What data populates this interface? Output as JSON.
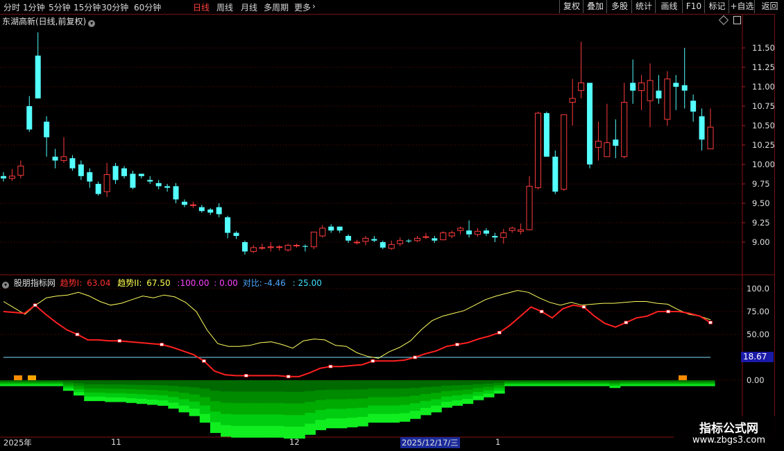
{
  "toolbar": {
    "periods": [
      {
        "label": "分时",
        "active": false
      },
      {
        "label": "1分钟",
        "active": false
      },
      {
        "label": "5分钟",
        "active": false
      },
      {
        "label": "15分钟",
        "active": false
      },
      {
        "label": "30分钟",
        "active": false
      },
      {
        "label": "60分钟",
        "active": false
      },
      {
        "label": "日线",
        "active": true
      },
      {
        "label": "周线",
        "active": false
      },
      {
        "label": "月线",
        "active": false
      },
      {
        "label": "多周期",
        "active": false
      },
      {
        "label": "更多",
        "active": false
      }
    ],
    "right_buttons": [
      "复权",
      "叠加",
      "多股",
      "统计",
      "画线",
      "F10",
      "标记",
      "+自选",
      "返回"
    ]
  },
  "symbol_title": "东湖高新(日线,前复权)",
  "indicator": {
    "name": "股朋指标网",
    "trend1_label": "趋势I:",
    "trend1_value": "63.04",
    "trend2_label": "趋势II:",
    "trend2_value": "67.50",
    "c100": ":100.00",
    "c0": ": 0.00",
    "contrast_label": "对比:",
    "contrast_value": "-4.46",
    "c25": ": 25.00"
  },
  "price_axis": [
    "11.50",
    "11.25",
    "11.00",
    "10.75",
    "10.50",
    "10.25",
    "10.00",
    "9.75",
    "9.50",
    "9.25",
    "9.00"
  ],
  "ind_axis": [
    "100.0",
    "75.00",
    "50.00",
    "0.00"
  ],
  "level_box": "18.67",
  "date_labels": [
    "2025年",
    "11",
    "12",
    "1"
  ],
  "cursor_date": "2025/12/17/三",
  "watermark": {
    "line1": "指标公式网",
    "line2": "www.zbgs3.com"
  },
  "colors": {
    "up": "#ff3c3c",
    "down": "#54ffff",
    "trend1": "#ff2020",
    "trend2": "#ffff60"
  },
  "chart_data": {
    "type": "candlestick",
    "candles": [
      [
        9.85,
        9.82,
        9.9,
        9.78
      ],
      [
        9.82,
        9.85,
        9.94,
        9.79
      ],
      [
        9.86,
        9.98,
        10.05,
        9.82
      ],
      [
        10.75,
        10.45,
        10.88,
        10.42
      ],
      [
        11.4,
        10.85,
        11.7,
        10.85
      ],
      [
        10.55,
        10.35,
        10.62,
        10.1
      ],
      [
        10.1,
        10.05,
        10.2,
        9.95
      ],
      [
        10.05,
        10.1,
        10.35,
        10.02
      ],
      [
        10.08,
        9.95,
        10.12,
        9.92
      ],
      [
        10.0,
        9.85,
        10.05,
        9.8
      ],
      [
        9.9,
        9.78,
        9.95,
        9.7
      ],
      [
        9.75,
        9.62,
        9.78,
        9.6
      ],
      [
        9.65,
        9.87,
        10.02,
        9.58
      ],
      [
        9.98,
        9.8,
        10.02,
        9.75
      ],
      [
        9.95,
        9.85,
        9.98,
        9.82
      ],
      [
        9.88,
        9.7,
        9.92,
        9.68
      ],
      [
        9.88,
        9.85,
        9.88,
        9.82
      ],
      [
        9.8,
        9.78,
        9.85,
        9.75
      ],
      [
        9.76,
        9.72,
        9.8,
        9.68
      ],
      [
        9.72,
        9.7,
        9.75,
        9.65
      ],
      [
        9.72,
        9.55,
        9.76,
        9.5
      ],
      [
        9.52,
        9.48,
        9.55,
        9.45
      ],
      [
        9.48,
        9.48,
        9.52,
        9.44
      ],
      [
        9.45,
        9.4,
        9.48,
        9.38
      ],
      [
        9.42,
        9.38,
        9.44,
        9.35
      ],
      [
        9.45,
        9.36,
        9.5,
        9.32
      ],
      [
        9.32,
        9.12,
        9.34,
        9.05
      ],
      [
        9.12,
        9.08,
        9.14,
        9.04
      ],
      [
        9.0,
        8.88,
        9.02,
        8.84
      ],
      [
        8.88,
        8.93,
        8.96,
        8.86
      ],
      [
        8.93,
        8.93,
        8.98,
        8.9
      ],
      [
        8.93,
        8.94,
        9.0,
        8.88
      ],
      [
        8.94,
        8.94,
        8.96,
        8.89
      ],
      [
        8.9,
        8.96,
        8.98,
        8.88
      ],
      [
        8.96,
        8.96,
        8.98,
        8.93
      ],
      [
        8.95,
        8.94,
        8.97,
        8.88
      ],
      [
        8.94,
        9.13,
        9.13,
        8.91
      ],
      [
        9.08,
        9.18,
        9.22,
        9.06
      ],
      [
        9.2,
        9.15,
        9.23,
        9.12
      ],
      [
        9.2,
        9.15,
        9.2,
        9.12
      ],
      [
        9.08,
        9.02,
        9.1,
        8.99
      ],
      [
        9.0,
        9.0,
        9.03,
        8.97
      ],
      [
        9.01,
        9.05,
        9.08,
        8.96
      ],
      [
        9.04,
        9.02,
        9.08,
        9.0
      ],
      [
        9.0,
        8.93,
        9.02,
        8.91
      ],
      [
        8.92,
        8.97,
        9.02,
        8.9
      ],
      [
        8.98,
        9.02,
        9.06,
        8.95
      ],
      [
        9.02,
        9.01,
        9.04,
        8.99
      ],
      [
        9.02,
        9.05,
        9.08,
        9.0
      ],
      [
        9.07,
        9.07,
        9.12,
        9.04
      ],
      [
        9.05,
        9.02,
        9.08,
        8.99
      ],
      [
        9.03,
        9.12,
        9.14,
        9.03
      ],
      [
        9.08,
        9.12,
        9.15,
        9.05
      ],
      [
        9.15,
        9.18,
        9.2,
        9.1
      ],
      [
        9.15,
        9.1,
        9.28,
        9.06
      ],
      [
        9.1,
        9.14,
        9.18,
        9.07
      ],
      [
        9.15,
        9.11,
        9.18,
        9.08
      ],
      [
        9.08,
        9.06,
        9.12,
        9.0
      ],
      [
        9.06,
        9.12,
        9.17,
        8.98
      ],
      [
        9.15,
        9.18,
        9.2,
        9.12
      ],
      [
        9.14,
        9.16,
        9.24,
        9.1
      ],
      [
        9.16,
        9.72,
        9.85,
        9.15
      ],
      [
        9.7,
        10.66,
        10.68,
        9.68
      ],
      [
        10.66,
        10.1,
        10.68,
        10.1
      ],
      [
        10.1,
        9.65,
        10.18,
        9.62
      ],
      [
        9.68,
        10.64,
        10.64,
        9.66
      ],
      [
        10.8,
        10.85,
        11.1,
        10.5
      ],
      [
        10.95,
        11.05,
        11.58,
        10.85
      ],
      [
        11.05,
        10.0,
        11.05,
        9.95
      ],
      [
        10.22,
        10.3,
        10.55,
        10.05
      ],
      [
        10.1,
        10.28,
        10.78,
        10.1
      ],
      [
        10.32,
        10.24,
        10.58,
        10.08
      ],
      [
        10.1,
        10.8,
        11.05,
        10.08
      ],
      [
        11.05,
        10.95,
        11.35,
        10.78
      ],
      [
        10.95,
        11.05,
        11.15,
        10.7
      ],
      [
        10.82,
        11.08,
        11.3,
        10.48
      ],
      [
        10.95,
        10.85,
        11.15,
        10.78
      ],
      [
        10.58,
        11.1,
        11.2,
        10.5
      ],
      [
        11.05,
        11.0,
        11.15,
        10.7
      ],
      [
        11.02,
        10.95,
        11.5,
        10.72
      ],
      [
        10.82,
        10.68,
        10.9,
        10.55
      ],
      [
        10.62,
        10.32,
        10.72,
        10.18
      ],
      [
        10.2,
        10.48,
        10.72,
        10.2
      ]
    ],
    "trend_lines": [
      {
        "name": "趋势I",
        "values": [
          75,
          74,
          73,
          82,
          72,
          63,
          55,
          50,
          44,
          44,
          43,
          43,
          42,
          41,
          40,
          39,
          36,
          32,
          28,
          21,
          10,
          6,
          5,
          5,
          5,
          5,
          5,
          4,
          4,
          8,
          13,
          15,
          15,
          16,
          17,
          21,
          21,
          21,
          22,
          25,
          29,
          32,
          37,
          39,
          41,
          45,
          48,
          52,
          60,
          70,
          80,
          75,
          68,
          78,
          82,
          80,
          70,
          62,
          58,
          63,
          68,
          70,
          75,
          75,
          75,
          73,
          70,
          63
        ]
      },
      {
        "name": "趋势II",
        "values": [
          86,
          79,
          72,
          82,
          90,
          92,
          93,
          96,
          92,
          86,
          82,
          84,
          88,
          92,
          90,
          93,
          91,
          85,
          75,
          55,
          40,
          37,
          37,
          38,
          41,
          42,
          39,
          35,
          43,
          45,
          44,
          38,
          37,
          30,
          26,
          24,
          31,
          36,
          43,
          55,
          65,
          70,
          73,
          76,
          82,
          88,
          92,
          95,
          98,
          96,
          90,
          85,
          82,
          85,
          82,
          83,
          84,
          84,
          85,
          86,
          86,
          84,
          83,
          77,
          72,
          70,
          66
        ]
      }
    ],
    "hline": 25
  }
}
